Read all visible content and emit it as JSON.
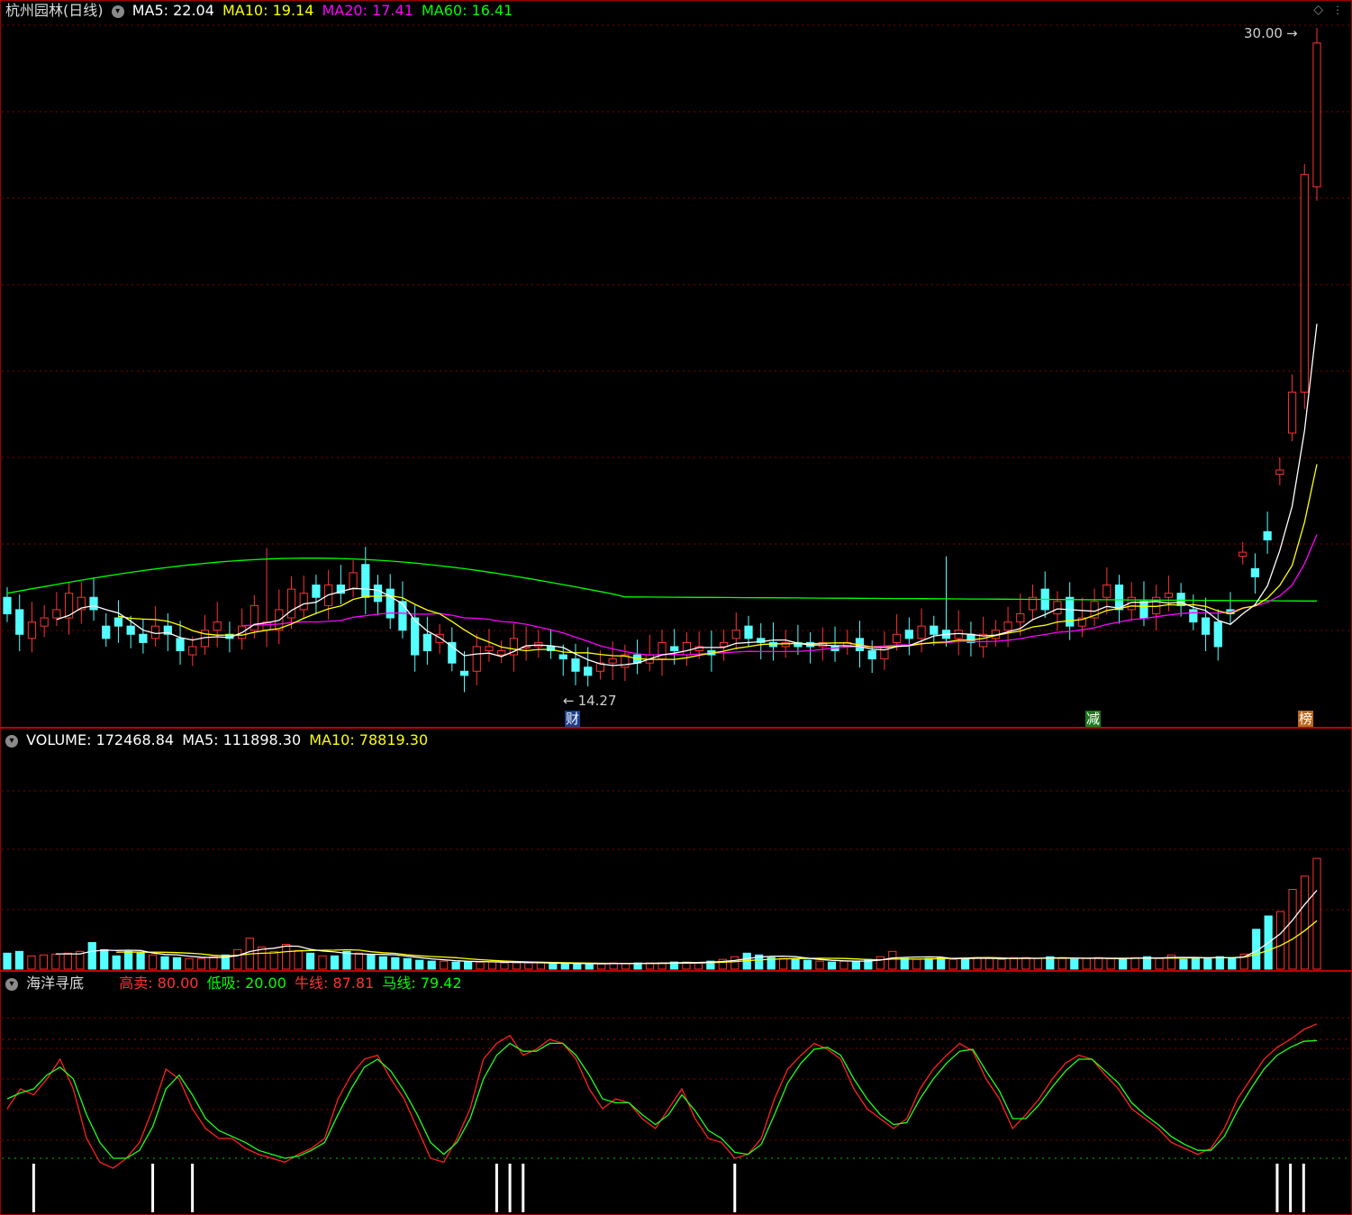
{
  "main_panel": {
    "title": "杭州园林(日线)",
    "ma5": "MA5: 22.04",
    "ma10": "MA10: 19.14",
    "ma20": "MA20: 17.41",
    "ma60": "MA60: 16.41",
    "high_marker": "30.00",
    "low_marker": "14.27",
    "event_tags": [
      "财",
      "减",
      "榜"
    ]
  },
  "volume_panel": {
    "volume": "VOLUME: 172468.84",
    "ma5": "MA5: 111898.30",
    "ma10": "MA10: 78819.30"
  },
  "indicator_panel": {
    "name": "海洋寻底",
    "sell": "高卖: 80.00",
    "buy": "低吸: 20.00",
    "bull": "牛线: 87.81",
    "horse": "马线: 79.42"
  },
  "colors": {
    "up": "#ff3232",
    "down": "#54ffff",
    "ma5": "#ffffff",
    "ma10": "#ffff00",
    "ma20": "#ff00ff",
    "ma60": "#00ff00",
    "grid": "#8a0000"
  },
  "icons": [
    "collapse-icon",
    "diamond-icon"
  ],
  "chart_data": {
    "type": "candlestick",
    "price": {
      "ylim": [
        13.5,
        30.5
      ],
      "open": [
        16.5,
        16.2,
        15.5,
        15.8,
        16.0,
        16.0,
        16.2,
        16.5,
        15.8,
        16.0,
        15.8,
        15.6,
        15.5,
        15.8,
        15.5,
        15.1,
        15.3,
        15.7,
        15.6,
        15.5,
        15.7,
        15.7,
        15.7,
        16.0,
        16.2,
        16.8,
        16.3,
        16.8,
        16.7,
        17.3,
        16.8,
        16.7,
        16.4,
        16.0,
        15.6,
        15.4,
        15.4,
        14.7,
        14.7,
        15.2,
        15.1,
        15.1,
        15.3,
        15.3,
        15.3,
        15.1,
        15.0,
        14.8,
        14.7,
        14.9,
        14.8,
        15.1,
        14.9,
        15.0,
        15.3,
        15.1,
        15.2,
        15.2,
        15.3,
        15.5,
        15.8,
        15.5,
        15.4,
        15.3,
        15.4,
        15.4,
        15.3,
        15.3,
        15.3,
        15.5,
        15.2,
        15.0,
        15.4,
        15.7,
        15.5,
        15.8,
        15.7,
        15.5,
        15.6,
        15.3,
        15.5,
        15.7,
        15.9,
        16.2,
        16.7,
        16.1,
        16.5,
        15.8,
        16.0,
        16.5,
        16.8,
        16.2,
        16.4,
        16.1,
        16.5,
        16.6,
        16.2,
        16.0,
        15.9,
        16.2,
        17.5,
        17.2,
        18.1,
        19.5,
        20.5,
        21.5,
        26.5
      ],
      "close": [
        16.1,
        15.6,
        15.9,
        16.0,
        16.2,
        16.6,
        16.5,
        16.2,
        15.5,
        15.8,
        15.6,
        15.4,
        15.8,
        15.6,
        15.2,
        15.3,
        15.7,
        15.9,
        15.5,
        15.8,
        16.3,
        15.9,
        16.2,
        16.7,
        16.6,
        16.5,
        16.8,
        16.6,
        17.1,
        16.5,
        16.4,
        16.0,
        15.7,
        15.1,
        15.2,
        15.6,
        14.9,
        14.6,
        15.3,
        15.3,
        15.2,
        15.5,
        15.3,
        15.4,
        15.2,
        15.0,
        14.7,
        14.6,
        14.9,
        15.0,
        15.1,
        14.9,
        15.1,
        15.4,
        15.2,
        15.4,
        15.3,
        15.1,
        15.4,
        15.7,
        15.5,
        15.4,
        15.3,
        15.4,
        15.3,
        15.3,
        15.4,
        15.2,
        15.4,
        15.2,
        15.0,
        15.3,
        15.6,
        15.5,
        15.8,
        15.6,
        15.5,
        15.7,
        15.4,
        15.6,
        15.7,
        15.9,
        16.1,
        16.5,
        16.2,
        16.4,
        15.8,
        16.0,
        16.4,
        16.8,
        16.2,
        16.5,
        16.0,
        16.5,
        16.6,
        16.3,
        15.9,
        15.6,
        15.3,
        16.1,
        17.6,
        17.0,
        17.9,
        19.6,
        21.5,
        26.8,
        30.0
      ],
      "ma60_start": 16.6,
      "ma60_end": 16.41
    },
    "volume": {
      "ylim": [
        0,
        240000
      ],
      "values": [
        18,
        20,
        15,
        16,
        17,
        18,
        20,
        30,
        22,
        15,
        20,
        18,
        16,
        14,
        13,
        12,
        12,
        14,
        16,
        22,
        35,
        25,
        20,
        28,
        21,
        18,
        15,
        15,
        20,
        18,
        16,
        14,
        13,
        12,
        10,
        9,
        9,
        8,
        8,
        8,
        8,
        7,
        7,
        7,
        7,
        6,
        6,
        6,
        6,
        6,
        7,
        6,
        7,
        7,
        7,
        8,
        8,
        7,
        9,
        11,
        14,
        18,
        16,
        13,
        12,
        11,
        10,
        9,
        8,
        9,
        9,
        11,
        14,
        20,
        12,
        11,
        12,
        13,
        11,
        12,
        13,
        12,
        11,
        13,
        13,
        12,
        14,
        12,
        11,
        12,
        13,
        12,
        11,
        13,
        14,
        12,
        16,
        11,
        13,
        12,
        14,
        13,
        17,
        45,
        60,
        65,
        90,
        105,
        125
      ],
      "scale_note": "thousands"
    },
    "indicator": {
      "ylim": [
        0,
        100
      ],
      "sell_level": 80,
      "buy_level": 20,
      "bull": [
        45,
        55,
        52,
        60,
        70,
        55,
        30,
        18,
        15,
        20,
        28,
        45,
        65,
        60,
        45,
        35,
        30,
        30,
        25,
        22,
        20,
        18,
        22,
        25,
        30,
        50,
        62,
        70,
        72,
        60,
        50,
        35,
        20,
        18,
        30,
        45,
        70,
        78,
        82,
        72,
        75,
        80,
        78,
        70,
        55,
        45,
        50,
        48,
        40,
        35,
        45,
        55,
        40,
        30,
        28,
        20,
        22,
        30,
        50,
        65,
        72,
        78,
        75,
        70,
        55,
        45,
        40,
        35,
        40,
        55,
        65,
        72,
        78,
        74,
        60,
        50,
        35,
        42,
        50,
        60,
        68,
        72,
        70,
        62,
        55,
        45,
        40,
        35,
        28,
        25,
        22,
        25,
        35,
        50,
        60,
        70,
        76,
        80,
        85,
        87.81
      ],
      "horse": [
        50,
        53,
        55,
        62,
        66,
        60,
        42,
        28,
        20,
        20,
        24,
        36,
        55,
        62,
        52,
        40,
        34,
        31,
        28,
        24,
        22,
        20,
        21,
        24,
        28,
        42,
        55,
        66,
        70,
        64,
        54,
        42,
        28,
        22,
        28,
        40,
        60,
        72,
        78,
        74,
        74,
        78,
        78,
        72,
        62,
        50,
        48,
        48,
        42,
        37,
        42,
        52,
        44,
        34,
        30,
        23,
        22,
        27,
        42,
        58,
        68,
        75,
        76,
        72,
        60,
        50,
        42,
        37,
        38,
        50,
        60,
        68,
        74,
        75,
        64,
        54,
        40,
        40,
        47,
        56,
        64,
        70,
        70,
        64,
        58,
        48,
        42,
        37,
        31,
        27,
        24,
        24,
        31,
        44,
        55,
        65,
        72,
        76,
        79,
        79.42
      ],
      "signals": [
        2,
        11,
        14,
        37,
        38,
        39,
        55,
        96,
        97,
        98
      ]
    }
  }
}
